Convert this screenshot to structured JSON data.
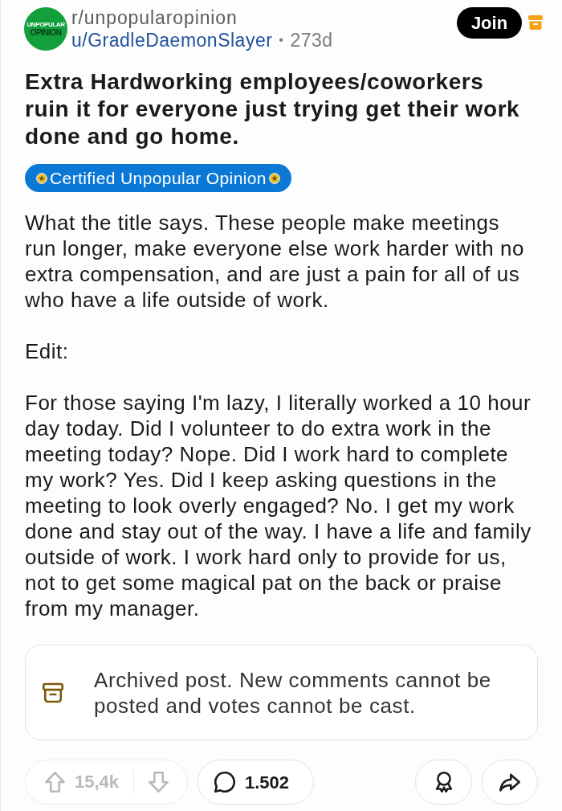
{
  "header": {
    "community_icon": {
      "texts": [
        "UNPOPULAR",
        "OPINION"
      ]
    },
    "subreddit": "r/unpopularopinion",
    "author": "u/GradleDaemonSlayer",
    "separator": "•",
    "age": "273d",
    "join_button": "Join",
    "archived": true
  },
  "title": "Extra Hardworking employees/coworkers ruin it for everyone just trying get their work done and go home.",
  "flair": {
    "text": "Certified Unpopular Opinion"
  },
  "body": [
    "What the title says. These people make meetings run longer, make everyone else work harder with no extra compensation, and are just a pain for all of us who have a life outside of work.",
    "Edit:",
    "For those saying I'm lazy, I literally worked a 10 hour day today. Did I volunteer to do extra work in the meeting today? Nope. Did I work hard to complete my work? Yes. Did I keep asking questions in the meeting to look overly engaged? No. I get my work done and stay out of the way. I have a life and family outside of work. I work hard only to provide for us, not to get some magical pat on the back or praise from my manager."
  ],
  "notice": {
    "text": "Archived post. New comments cannot be posted and votes cannot be cast."
  },
  "actions": {
    "score": "15,4k",
    "voting_disabled": true,
    "comments": "1.502"
  }
}
